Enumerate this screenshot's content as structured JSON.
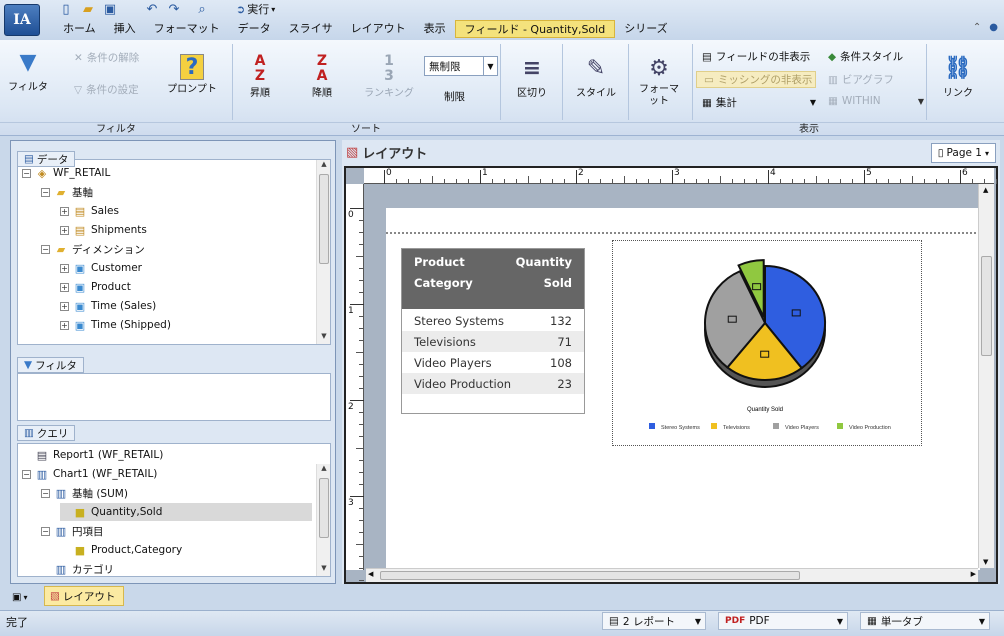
{
  "quick_access": {
    "run_label": "実行"
  },
  "menu": {
    "tabs": [
      "ホーム",
      "挿入",
      "フォーマット",
      "データ",
      "スライサ",
      "レイアウト",
      "表示",
      "フィールド - Quantity,Sold",
      "シリーズ"
    ],
    "active_index": 7
  },
  "ribbon": {
    "filter_group": {
      "filter": "フィルタ",
      "remove_condition": "条件の解除",
      "set_condition": "条件の設定",
      "prompt": "プロンプト",
      "label": "フィルタ"
    },
    "sort_group": {
      "ascending": "昇順",
      "descending": "降順",
      "ranking": "ランキング",
      "limit_value": "無制限",
      "limit": "制限",
      "label": "ソート"
    },
    "break": "区切り",
    "style": "スタイル",
    "format": "フォーマット",
    "display_group": {
      "hide_field": "フィールドの非表示",
      "hide_missing": "ミッシングの非表示",
      "aggregate": "集計",
      "cond_style": "条件スタイル",
      "bar_graph": "ビアグラフ",
      "within": "WITHIN",
      "label": "表示"
    },
    "link": "リンク"
  },
  "left": {
    "data_header": "データ",
    "data_tree": [
      {
        "label": "WF_RETAIL",
        "level": 0,
        "exp": "−",
        "icon": "cube-icon"
      },
      {
        "label": "基軸",
        "level": 1,
        "exp": "−",
        "icon": "folder-icon"
      },
      {
        "label": "Sales",
        "level": 2,
        "exp": "+",
        "icon": "measure-icon"
      },
      {
        "label": "Shipments",
        "level": 2,
        "exp": "+",
        "icon": "measure-icon"
      },
      {
        "label": "ディメンション",
        "level": 1,
        "exp": "−",
        "icon": "folder-icon"
      },
      {
        "label": "Customer",
        "level": 2,
        "exp": "+",
        "icon": "dimension-icon"
      },
      {
        "label": "Product",
        "level": 2,
        "exp": "+",
        "icon": "dimension-icon"
      },
      {
        "label": "Time (Sales)",
        "level": 2,
        "exp": "+",
        "icon": "dimension-icon"
      },
      {
        "label": "Time (Shipped)",
        "level": 2,
        "exp": "+",
        "icon": "dimension-icon"
      }
    ],
    "filter_header": "フィルタ",
    "query_header": "クエリ",
    "query_tree": [
      {
        "label": "Report1 (WF_RETAIL)",
        "level": 0,
        "exp": "",
        "icon": "report-icon"
      },
      {
        "label": "Chart1 (WF_RETAIL)",
        "level": 0,
        "exp": "−",
        "icon": "chart-icon"
      },
      {
        "label": "基軸 (SUM)",
        "level": 1,
        "exp": "−",
        "icon": "axis-icon"
      },
      {
        "label": "Quantity,Sold",
        "level": 2,
        "exp": "",
        "icon": "field-icon",
        "selected": true
      },
      {
        "label": "円項目",
        "level": 1,
        "exp": "−",
        "icon": "axis-icon"
      },
      {
        "label": "Product,Category",
        "level": 2,
        "exp": "",
        "icon": "field-icon"
      },
      {
        "label": "カテゴリ",
        "level": 1,
        "exp": "",
        "icon": "axis-icon"
      }
    ]
  },
  "layout": {
    "title": "レイアウト",
    "page_label": "Page 1",
    "ruler_marks": [
      "0",
      "1",
      "2",
      "3",
      "4",
      "5",
      "6"
    ],
    "vruler_marks": [
      "0",
      "1",
      "2",
      "3"
    ]
  },
  "report_table": {
    "headers": {
      "col1_line1": "Product",
      "col1_line2": "Category",
      "col2_line1": "Quantity",
      "col2_line2": "Sold"
    },
    "rows": [
      {
        "category": "Stereo Systems",
        "qty": "132"
      },
      {
        "category": "Televisions",
        "qty": "71"
      },
      {
        "category": "Video Players",
        "qty": "108"
      },
      {
        "category": "Video Production",
        "qty": "23"
      }
    ]
  },
  "chart_data": {
    "type": "pie",
    "title": "Quantity Sold",
    "categories": [
      "Stereo Systems",
      "Televisions",
      "Video Players",
      "Video Production"
    ],
    "values": [
      132,
      71,
      108,
      23
    ],
    "colors": [
      "#2f5ee0",
      "#f0c020",
      "#a0a0a0",
      "#90c840"
    ],
    "legend_position": "bottom"
  },
  "bottom": {
    "tab_label": "レイアウト"
  },
  "status": {
    "text": "完了",
    "reports": "2 レポート",
    "format": "PDF",
    "tab_mode": "単一タブ"
  }
}
